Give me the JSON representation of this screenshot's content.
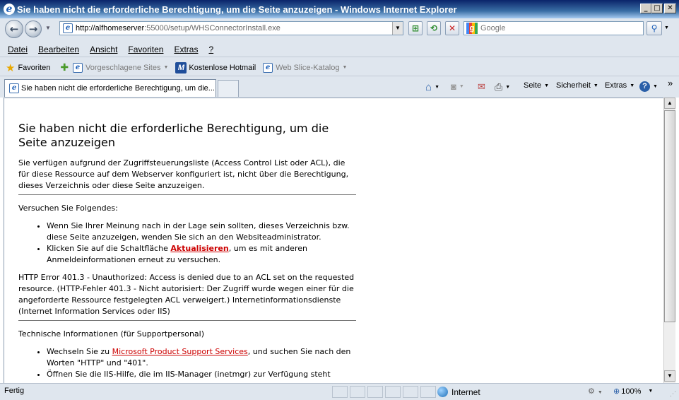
{
  "window": {
    "title": "Sie haben nicht die erforderliche Berechtigung, um die Seite anzuzeigen - Windows Internet Explorer",
    "minimize_glyph": "_",
    "maximize_glyph": "□",
    "close_glyph": "✕"
  },
  "address_bar": {
    "url_host": "http://alfhomeserver",
    "url_rest": ":55000/setup/WHSConnectorInstall.exe"
  },
  "search": {
    "placeholder": "Google"
  },
  "menu": [
    "Datei",
    "Bearbeiten",
    "Ansicht",
    "Favoriten",
    "Extras",
    "?"
  ],
  "favorites_bar": {
    "favorites_label": "Favoriten",
    "links": [
      {
        "label": "Vorgeschlagene Sites",
        "dim": true
      },
      {
        "label": "Kostenlose Hotmail",
        "dim": false
      },
      {
        "label": "Web Slice-Katalog",
        "dim": true
      }
    ]
  },
  "tabs": [
    {
      "label": "Sie haben nicht die erforderliche Berechtigung, um die..."
    }
  ],
  "command_bar": {
    "page": "Seite",
    "safety": "Sicherheit",
    "tools": "Extras",
    "overflow": "»"
  },
  "page": {
    "heading": "Sie haben nicht die erforderliche Berechtigung, um die Seite anzuzeigen",
    "intro": "Sie verfügen aufgrund der Zugriffsteuerungsliste (Access Control List oder ACL), die für diese Ressource auf dem Webserver konfiguriert ist, nicht über die Berechtigung, dieses Verzeichnis oder diese Seite anzuzeigen.",
    "try_heading": "Versuchen Sie Folgendes:",
    "try_item1": "Wenn Sie Ihrer Meinung nach in der Lage sein sollten, dieses Verzeichnis bzw. diese Seite anzuzeigen, wenden Sie sich an den Websiteadministrator.",
    "try_item2_before": "Klicken Sie auf die Schaltfläche ",
    "try_item2_link": "Aktualisieren",
    "try_item2_after": ", um es mit anderen Anmeldeinformationen erneut zu versuchen.",
    "error_text": "HTTP Error 401.3 - Unauthorized: Access is denied due to an ACL set on the requested resource. (HTTP-Fehler 401.3 - Nicht autorisiert: Der Zugriff wurde wegen einer für die angeforderte Ressource festgelegten ACL verweigert.) Internetinformationsdienste (Internet Information Services oder IIS)",
    "tech_heading": "Technische Informationen (für Supportpersonal)",
    "tech_item1_before": "Wechseln Sie zu ",
    "tech_item1_link": "Microsoft Product Support Services",
    "tech_item1_after": ", und suchen Sie nach den Worten \"HTTP\" und \"401\".",
    "tech_item2_partial": "Öffnen Sie die IIS-Hilfe, die im IIS-Manager (inetmgr) zur Verfügung steht"
  },
  "status_bar": {
    "status": "Fertig",
    "zone": "Internet",
    "zoom": "100%"
  },
  "colors": {
    "link_red": "#cc0000",
    "chrome_bg": "#dfe6ee"
  }
}
